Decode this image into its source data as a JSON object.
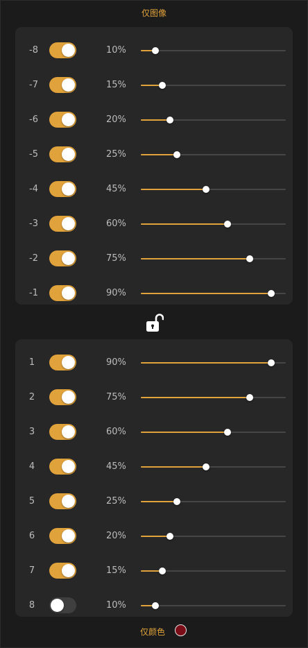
{
  "header": {
    "title": "仅图像"
  },
  "accent_color": "#e0a23b",
  "before_panel": {
    "rows": [
      {
        "label": "-8",
        "enabled": true,
        "percent_label": "10%",
        "value": 10
      },
      {
        "label": "-7",
        "enabled": true,
        "percent_label": "15%",
        "value": 15
      },
      {
        "label": "-6",
        "enabled": true,
        "percent_label": "20%",
        "value": 20
      },
      {
        "label": "-5",
        "enabled": true,
        "percent_label": "25%",
        "value": 25
      },
      {
        "label": "-4",
        "enabled": true,
        "percent_label": "45%",
        "value": 45
      },
      {
        "label": "-3",
        "enabled": true,
        "percent_label": "60%",
        "value": 60
      },
      {
        "label": "-2",
        "enabled": true,
        "percent_label": "75%",
        "value": 75
      },
      {
        "label": "-1",
        "enabled": true,
        "percent_label": "90%",
        "value": 90
      }
    ]
  },
  "lock": {
    "icon": "unlock-icon",
    "state": "unlocked"
  },
  "after_panel": {
    "rows": [
      {
        "label": "1",
        "enabled": true,
        "percent_label": "90%",
        "value": 90
      },
      {
        "label": "2",
        "enabled": true,
        "percent_label": "75%",
        "value": 75
      },
      {
        "label": "3",
        "enabled": true,
        "percent_label": "60%",
        "value": 60
      },
      {
        "label": "4",
        "enabled": true,
        "percent_label": "45%",
        "value": 45
      },
      {
        "label": "5",
        "enabled": true,
        "percent_label": "25%",
        "value": 25
      },
      {
        "label": "6",
        "enabled": true,
        "percent_label": "20%",
        "value": 20
      },
      {
        "label": "7",
        "enabled": true,
        "percent_label": "15%",
        "value": 15
      },
      {
        "label": "8",
        "enabled": false,
        "percent_label": "10%",
        "value": 10
      }
    ]
  },
  "footer": {
    "label": "仅颜色",
    "swatch_color": "#7a0d18"
  }
}
